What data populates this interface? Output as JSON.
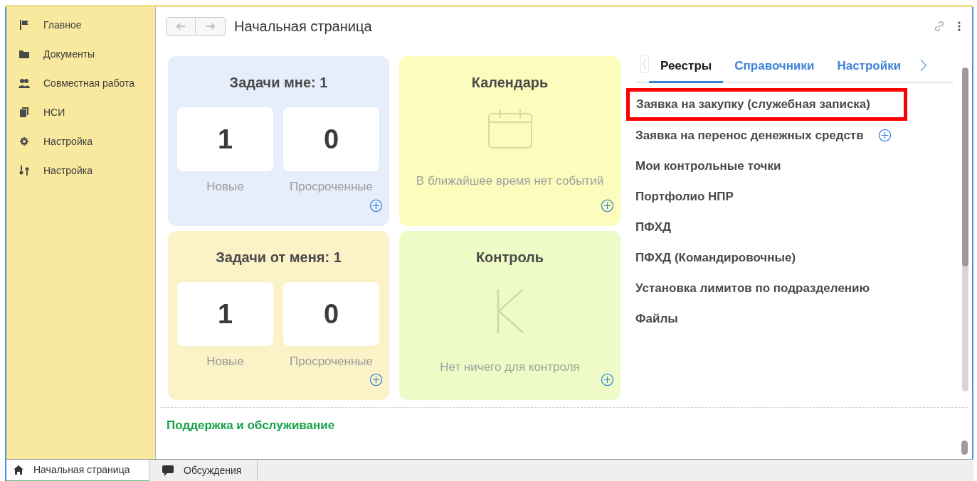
{
  "sidebar": {
    "items": [
      {
        "label": "Главное"
      },
      {
        "label": "Документы"
      },
      {
        "label": "Совместная работа"
      },
      {
        "label": "НСИ"
      },
      {
        "label": "Настройка"
      },
      {
        "label": "Настройка"
      }
    ]
  },
  "page": {
    "title": "Начальная страница"
  },
  "cards": [
    {
      "kind": "tasks",
      "title": "Задачи мне: 1",
      "color": "#e6edfb",
      "counters": [
        {
          "value": "1",
          "label": "Новые"
        },
        {
          "value": "0",
          "label": "Просроченные"
        }
      ]
    },
    {
      "kind": "calendar",
      "title": "Календарь",
      "color": "#fcfcbc",
      "message": "В ближайшее время нет событий"
    },
    {
      "kind": "tasks",
      "title": "Задачи от меня: 1",
      "color": "#fcf2c8",
      "counters": [
        {
          "value": "1",
          "label": "Новые"
        },
        {
          "value": "0",
          "label": "Просроченные"
        }
      ]
    },
    {
      "kind": "control",
      "title": "Контроль",
      "color": "#eefbc6",
      "message": "Нет ничего для контроля"
    }
  ],
  "panel": {
    "tabs": [
      {
        "label": "Реестры",
        "selected": true
      },
      {
        "label": "Справочники",
        "selected": false
      },
      {
        "label": "Настройки",
        "selected": false
      }
    ],
    "items": [
      {
        "label": "Заявка на закупку (служебная записка)",
        "highlighted": true,
        "add_button": false
      },
      {
        "label": "Заявка на перенос денежных средств",
        "highlighted": false,
        "add_button": true
      },
      {
        "label": "Мои контрольные точки",
        "highlighted": false,
        "add_button": false
      },
      {
        "label": "Портфолио НПР",
        "highlighted": false,
        "add_button": false
      },
      {
        "label": "ПФХД",
        "highlighted": false,
        "add_button": false
      },
      {
        "label": "ПФХД (Командировочные)",
        "highlighted": false,
        "add_button": false
      },
      {
        "label": "Установка лимитов по подразделению",
        "highlighted": false,
        "add_button": false
      },
      {
        "label": "Файлы",
        "highlighted": false,
        "add_button": false
      }
    ]
  },
  "support_link": "Поддержка и обслуживание",
  "bottom_tabs": [
    {
      "label": "Начальная страница",
      "selected": true
    },
    {
      "label": "Обсуждения",
      "selected": false
    }
  ]
}
